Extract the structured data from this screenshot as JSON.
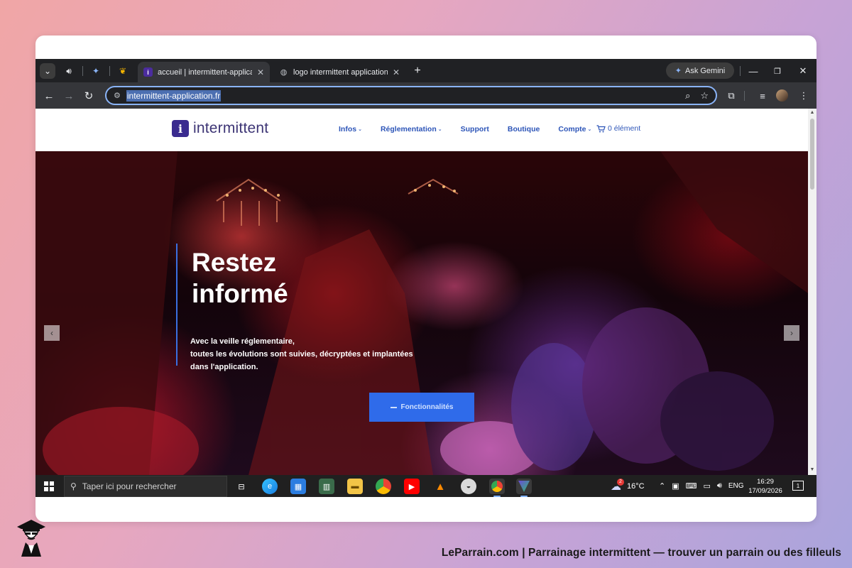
{
  "browser": {
    "tabs": [
      {
        "title": "accueil | intermittent-application",
        "favicon": "intermittent-logo-icon",
        "active": true
      },
      {
        "title": "logo intermittent application - Re",
        "favicon": "globe-icon",
        "active": false
      }
    ],
    "gemini_label": "Ask Gemini",
    "url_selected": "intermittent-application.fr"
  },
  "site": {
    "logo_mark": "i",
    "logo_text": "intermittent",
    "menu": [
      {
        "label": "Infos",
        "dropdown": true
      },
      {
        "label": "Réglementation",
        "dropdown": true
      },
      {
        "label": "Support",
        "dropdown": false
      },
      {
        "label": "Boutique",
        "dropdown": false
      },
      {
        "label": "Compte",
        "dropdown": true
      }
    ],
    "cart_label": "0 élément",
    "hero": {
      "title_line1": "Restez",
      "title_line2": "informé",
      "text_line1": "Avec la veille réglementaire,",
      "text_line2": "toutes les évolutions sont suivies, décryptées et implantées",
      "text_line3": "dans l'application.",
      "cta_label": "Fonctionnalités"
    }
  },
  "taskbar": {
    "search_placeholder": "Taper ici pour rechercher",
    "weather_badge": "2",
    "temperature": "16°C",
    "language": "ENG",
    "time": "16:29",
    "date": "17/09/2026",
    "notification_count": "1"
  },
  "footer": {
    "caption": "LeParrain.com | Parrainage intermittent — trouver un parrain ou des filleuls"
  },
  "colors": {
    "accent": "#2f6bea",
    "brand": "#3a2b8f",
    "menu_text": "#2d55b8"
  }
}
